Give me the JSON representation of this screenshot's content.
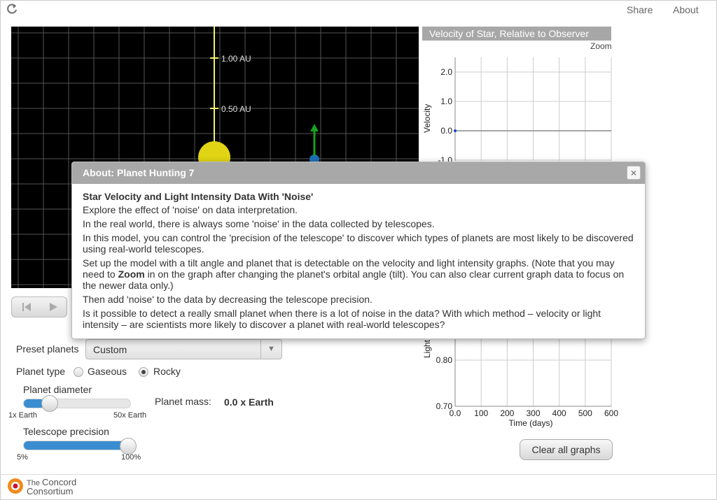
{
  "header": {
    "reload_icon": "reload-icon",
    "share_label": "Share",
    "about_label": "About"
  },
  "simulation": {
    "scale_labels": [
      "1.00 AU",
      "0.50 AU"
    ],
    "colors": {
      "background": "#000000",
      "grid": "#555555",
      "axis": "#f2f26e",
      "star": "#e0d414",
      "planet": "#1c6fb5",
      "arrow": "#18a01c"
    }
  },
  "playback": {
    "rewind_icon": "skip-back-icon",
    "play_icon": "play-icon"
  },
  "settings": {
    "preset_label": "Preset planets",
    "preset_value": "Custom",
    "planet_type_label": "Planet type",
    "type_options": [
      "Gaseous",
      "Rocky"
    ],
    "type_selected": "Rocky",
    "diameter_label": "Planet diameter",
    "diameter_min": "1x Earth",
    "diameter_max": "50x Earth",
    "diameter_fraction": 0.2,
    "mass_label": "Planet mass:",
    "mass_value": "0.0 x Earth",
    "precision_label": "Telescope precision",
    "precision_min": "5%",
    "precision_max": "100%",
    "precision_fraction": 1.0
  },
  "graph": {
    "title": "Velocity of Star, Relative to Observer",
    "zoom_label": "Zoom",
    "velocity_ylabel": "Velocity",
    "velocity_ticks": [
      "2.0",
      "1.0",
      "0.0",
      "-1.0"
    ],
    "light_ylabel": "Light",
    "light_ticks": [
      "0.80",
      "0.70"
    ],
    "x_ticks": [
      "0.0",
      "100",
      "200",
      "300",
      "400",
      "500",
      "600"
    ],
    "xlabel": "Time (days)",
    "clear_label": "Clear all graphs"
  },
  "dialog": {
    "title": "About: Planet Hunting 7",
    "close_icon": "close-icon",
    "heading": "Star Velocity and Light Intensity Data With 'Noise'",
    "p1": "Explore the effect of 'noise' on data interpretation.",
    "p2": "In the real world, there is always some 'noise' in the data collected by telescopes.",
    "p3": "In this model, you can control the 'precision of the telescope' to discover which types of planets are most likely to be discovered using real-world telescopes.",
    "p4_a": "Set up the model with a tilt angle and planet that is detectable on the velocity and light intensity graphs. (Note that you may need to ",
    "p4_bold": "Zoom",
    "p4_b": " in on the graph after changing the planet's orbital angle (tilt). You can also clear current graph data to focus on the newer data only.)",
    "p5": "Then add 'noise' to the data by decreasing the telescope precision.",
    "p6": "Is it possible to detect a really small planet when there is a lot of noise in the data? With which method – velocity or light intensity – are scientists more likely to discover a planet with real-world telescopes?"
  },
  "footer": {
    "logo_line1": "The",
    "logo_line2": "Concord",
    "logo_line3": "Consortium"
  },
  "chart_data": [
    {
      "type": "line",
      "title": "Velocity of Star, Relative to Observer",
      "ylabel": "Velocity",
      "xlabel": "Time (days)",
      "ylim": [
        -1.0,
        2.0
      ],
      "xlim": [
        0,
        600
      ],
      "series": [
        {
          "x": [
            0,
            600
          ],
          "values": [
            0.0,
            0.0
          ]
        }
      ]
    },
    {
      "type": "line",
      "ylabel": "Light",
      "xlabel": "Time (days)",
      "ylim": [
        0.7,
        0.8
      ],
      "xlim": [
        0,
        600
      ],
      "series": []
    }
  ]
}
